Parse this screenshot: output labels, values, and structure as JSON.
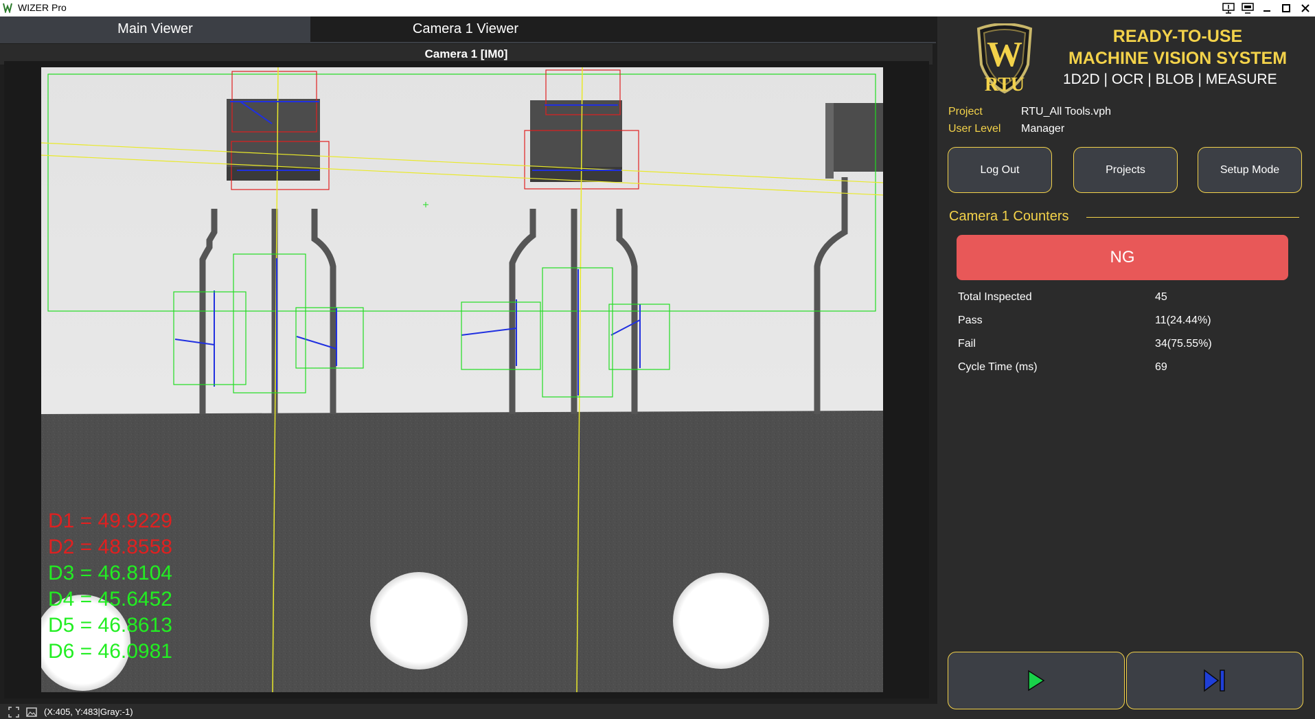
{
  "window": {
    "title": "WIZER Pro",
    "icons": [
      "app-icon",
      "remote-display-icon",
      "settings-display-icon",
      "minimize-icon",
      "maximize-icon",
      "close-icon"
    ]
  },
  "tabs": [
    {
      "label": "Main Viewer",
      "active": true
    },
    {
      "label": "Camera 1 Viewer",
      "active": false
    }
  ],
  "viewer": {
    "title": "Camera 1  [IM0]",
    "measurements": [
      {
        "label": "D1 = 49.9229",
        "status": "fail",
        "color": "#e02020"
      },
      {
        "label": "D2 = 48.8558",
        "status": "fail",
        "color": "#e02020"
      },
      {
        "label": "D3 = 46.8104",
        "status": "pass",
        "color": "#22ee22"
      },
      {
        "label": "D4 = 45.6452",
        "status": "pass",
        "color": "#22ee22"
      },
      {
        "label": "D5 = 46.8613",
        "status": "pass",
        "color": "#22ee22"
      },
      {
        "label": "D6 = 46.0981",
        "status": "pass",
        "color": "#22ee22"
      }
    ]
  },
  "status_bar": {
    "coords": "(X:405, Y:483|Gray:-1)",
    "icons": [
      "fit-view-icon",
      "image-icon"
    ]
  },
  "brand": {
    "logo_text": "RTU",
    "logo_letter": "W",
    "tagline_1": "READY-TO-USE",
    "tagline_2": "MACHINE VISION SYSTEM",
    "tools": "1D2D | OCR | BLOB | MEASURE"
  },
  "info": {
    "project_label": "Project",
    "project_value": "RTU_All Tools.vph",
    "user_level_label": "User Level",
    "user_level_value": "Manager"
  },
  "buttons": {
    "logout": "Log Out",
    "projects": "Projects",
    "setup": "Setup Mode"
  },
  "counters": {
    "title": "Camera 1 Counters",
    "result": "NG",
    "result_color": "#e85858",
    "rows": [
      {
        "label": "Total Inspected",
        "value": "45"
      },
      {
        "label": "Pass",
        "value": "11(24.44%)"
      },
      {
        "label": "Fail",
        "value": "34(75.55%)"
      },
      {
        "label": "Cycle Time (ms)",
        "value": "69"
      }
    ]
  },
  "run_controls": {
    "icons": [
      "play-icon",
      "step-icon"
    ],
    "play_color": "#19d24a",
    "step_color": "#1f3fd8"
  },
  "colors": {
    "accent": "#f3d24a",
    "panel": "#3c3f45",
    "background": "#2b2b2b"
  }
}
